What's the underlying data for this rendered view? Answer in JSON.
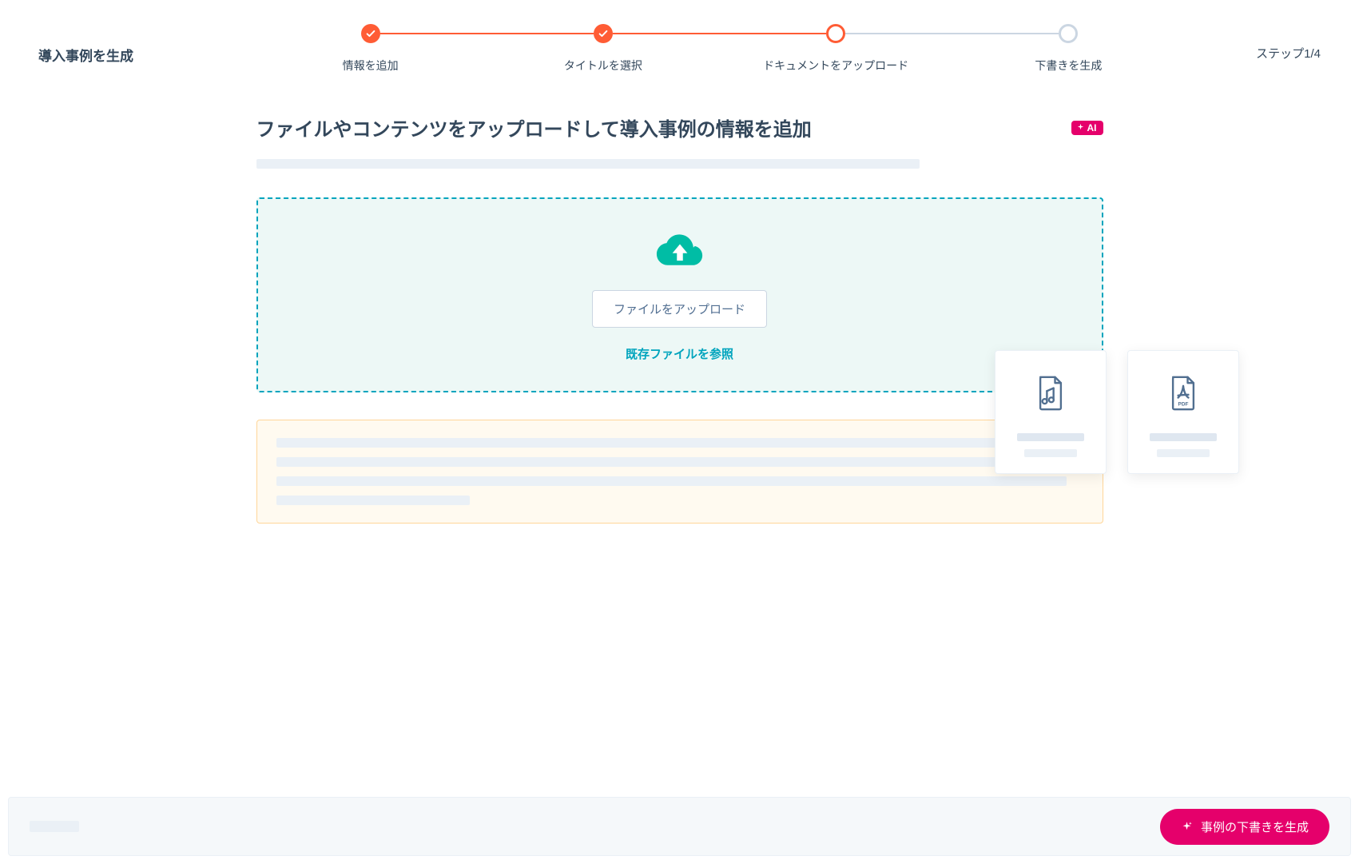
{
  "page": {
    "title": "導入事例を生成",
    "step_counter": "ステップ1/4"
  },
  "stepper": {
    "steps": [
      {
        "label": "情報を追加",
        "state": "completed"
      },
      {
        "label": "タイトルを選択",
        "state": "completed"
      },
      {
        "label": "ドキュメントをアップロード",
        "state": "current"
      },
      {
        "label": "下書きを生成",
        "state": "upcoming"
      }
    ]
  },
  "main": {
    "heading": "ファイルやコンテンツをアップロードして導入事例の情報を追加",
    "ai_badge_label": "AI"
  },
  "upload": {
    "button_label": "ファイルをアップロード",
    "browse_label": "既存ファイルを参照"
  },
  "file_cards": [
    {
      "icon": "music",
      "name": "music-file-icon"
    },
    {
      "icon": "pdf",
      "name": "pdf-file-icon"
    }
  ],
  "footer": {
    "generate_label": "事例の下書きを生成"
  },
  "colors": {
    "accent_orange": "#ff5c35",
    "accent_teal": "#00bda5",
    "accent_pink": "#e5006b",
    "text": "#33475b"
  }
}
